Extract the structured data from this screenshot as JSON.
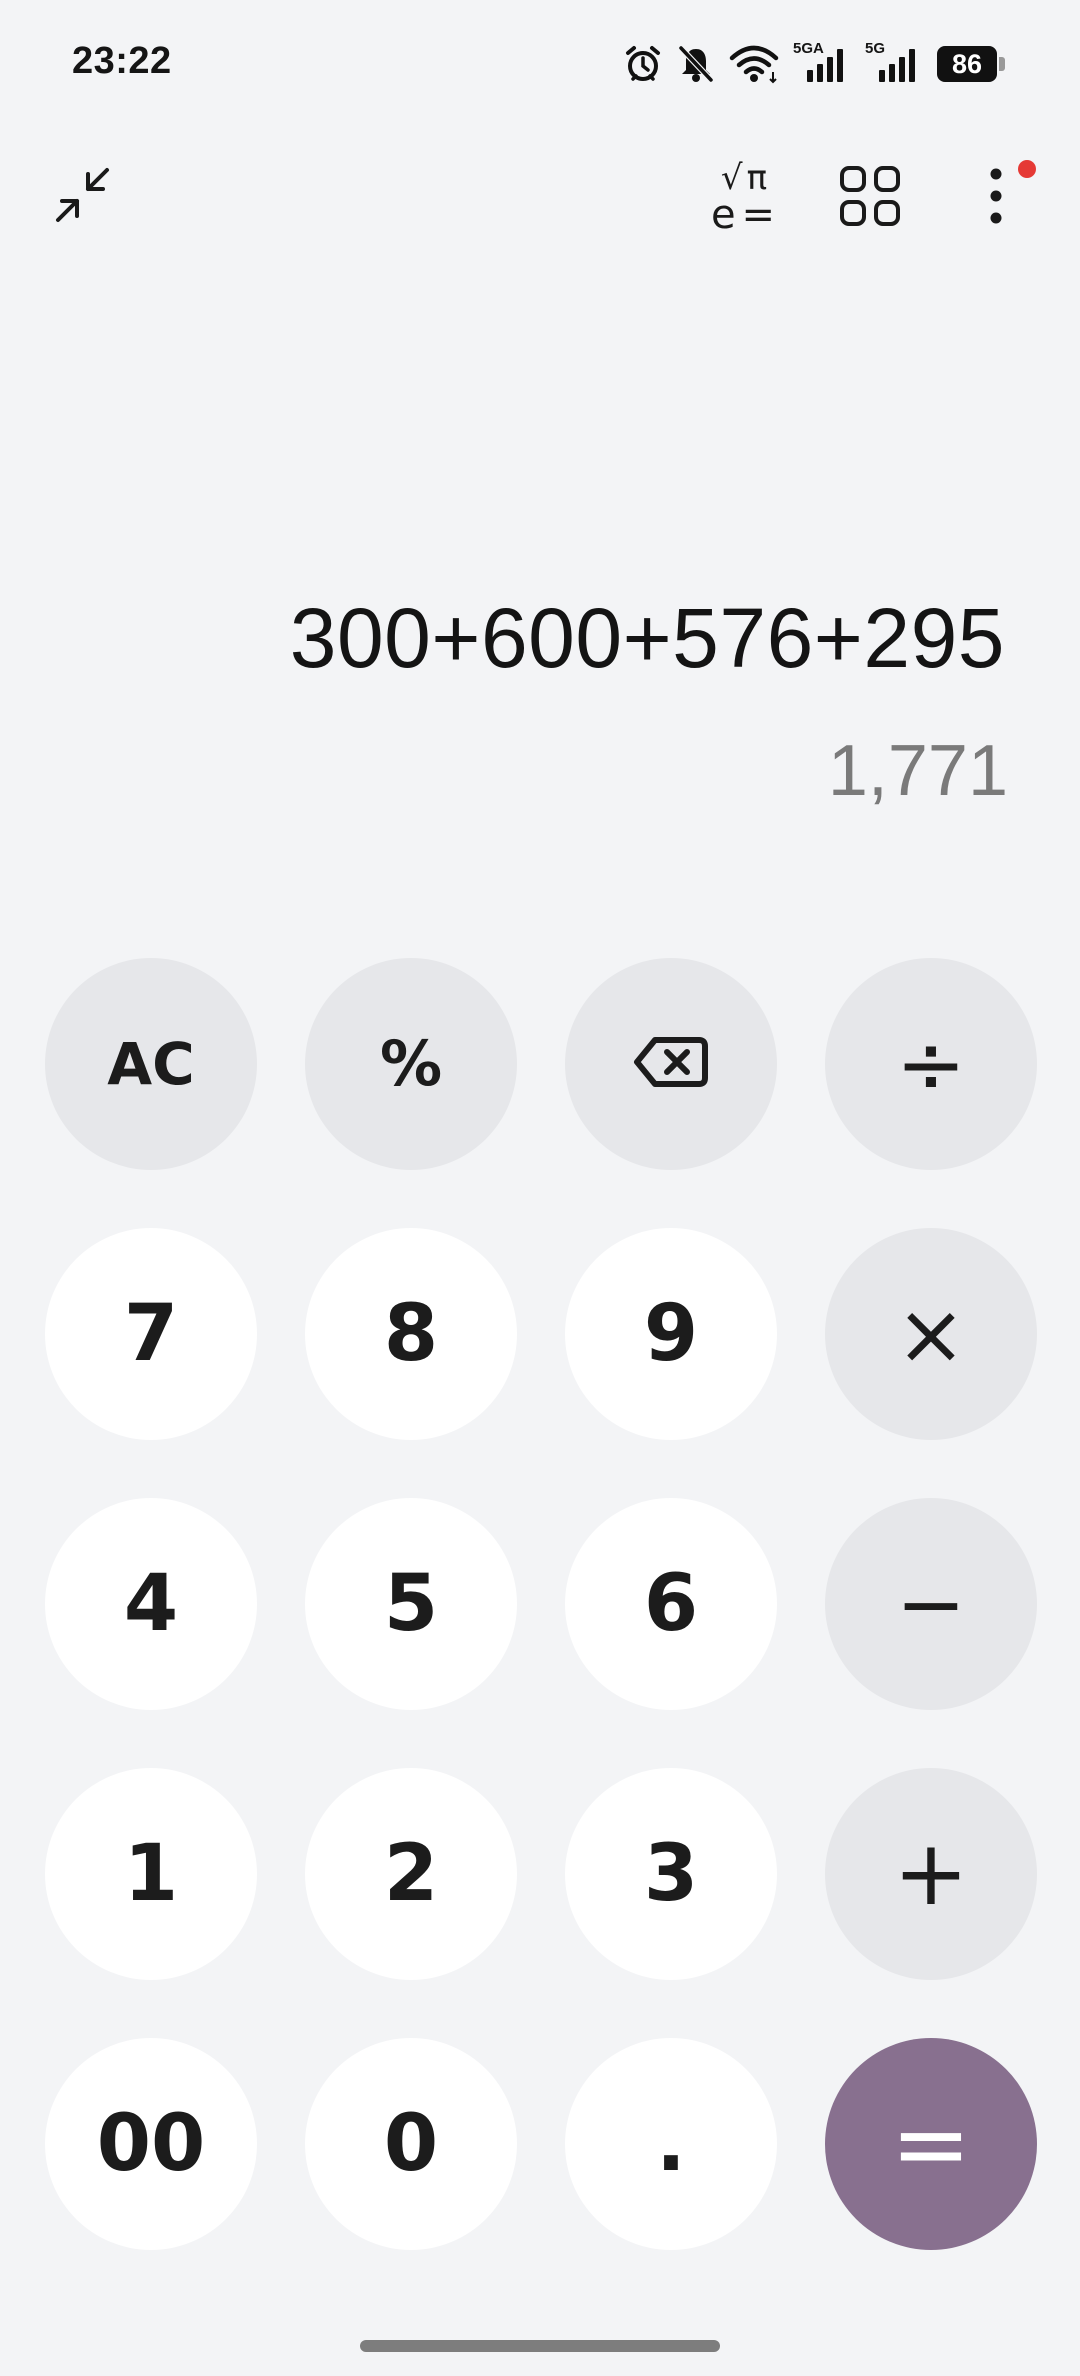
{
  "status_bar": {
    "time": "23:22",
    "icons": [
      "alarm-icon",
      "bell-muted-icon",
      "wifi-icon",
      "signal-5ga-icon",
      "signal-5g-icon"
    ],
    "network1": "5GA",
    "network2": "5G",
    "battery": "86"
  },
  "toolbar": {
    "icons": [
      "collapse-icon",
      "scientific-icon",
      "apps-grid-icon",
      "more-menu-icon"
    ],
    "scientific_top": "√π",
    "scientific_bottom": "e="
  },
  "display": {
    "expression": "300+600+576+295",
    "result": "1,771"
  },
  "keypad": {
    "ac": "AC",
    "percent": "%",
    "divide": "÷",
    "multiply": "×",
    "minus": "−",
    "plus": "+",
    "equals": "=",
    "digits": [
      "7",
      "8",
      "9",
      "4",
      "5",
      "6",
      "1",
      "2",
      "3",
      "00",
      "0",
      "."
    ]
  },
  "colors": {
    "background": "#f3f4f6",
    "digit_key": "#ffffff",
    "function_key": "#e6e7ea",
    "equals_key": "#88708f",
    "result_text": "#7a7a7a",
    "notification_dot": "#e53935"
  }
}
